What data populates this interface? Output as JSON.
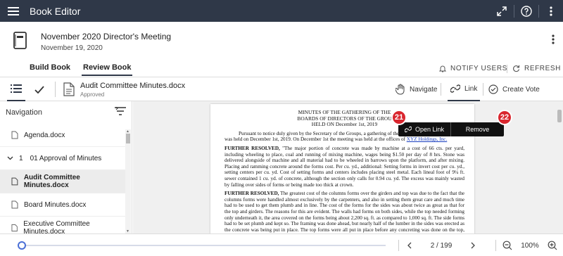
{
  "app": {
    "title": "Book Editor"
  },
  "meeting": {
    "title": "November 2020 Director's Meeting",
    "date": "November 19, 2020"
  },
  "tabs": [
    {
      "label": "Build Book",
      "active": false
    },
    {
      "label": "Review Book",
      "active": true
    }
  ],
  "actions": {
    "notify_users": "NOTIFY USERS",
    "refresh": "REFRESH"
  },
  "document": {
    "name": "Audit Committee Minutes.docx",
    "status": "Approved"
  },
  "modes": {
    "navigate": "Navigate",
    "link": "Link",
    "create_vote": "Create Vote",
    "active": "link"
  },
  "navigation": {
    "title": "Navigation",
    "items": [
      {
        "label": "Agenda.docx",
        "type": "file"
      },
      {
        "label": "01 Approval of Minutes",
        "type": "section",
        "number": "1"
      },
      {
        "label": "Audit Committee Minutes.docx",
        "type": "file",
        "selected": true
      },
      {
        "label": "Board Minutes.docx",
        "type": "file"
      },
      {
        "label": "Executive Committee Minutes.docx",
        "type": "file"
      }
    ]
  },
  "page_content": {
    "heading": [
      "MINUTES OF THE GATHERING OF THE",
      "BOARDS OF DIRECTORS OF THE GROU",
      "HELD ON December 1st, 2019"
    ],
    "para1_a": "Pursuant to notice duly given by the Secretary of the Groups, a gathering of the",
    "para1_b": "was held on December 1st, 2019. On December 1st the meeting was held at the offices of",
    "para1_link": "XYZ Holdings, Inc.",
    "para2_lead": "FURTHER RESOLVED,",
    "para2_body": " \"The major portion of concrete was made by machine at a cost of 66 cts. per yard, including wheeling to place, coal and running of mixing machine, wages being $1.50 per day of 8 hrs. Stone was delivered alongside of machine and all material had to be wheeled in barrows upon the platform, and after mixing. Placing and ramming concrete around the forms cost. Per cu. yd., additional: Setting forms in invert cost per cu. yd., setting centers per cu. yd. Cost of setting forms and centers includes placing steel metal. Each lineal foot of 9¼ ft. sewer contained 1 cu. yd. of concrete, although the section only calls for 0.94 cu. yd. The excess was mainly wasted by falling over sides of forms or being made too thick at crown.",
    "para3_lead": "FURTHER RESOLVED,",
    "para3_body": " The greatest cost of the columns forms over the girders and top was due to the fact that the columns forms were handled almost exclusively by the carpenters, and also in setting them great care and much time had to be used to get them plumb and in line. The cost of the forms for the sides was about twice as great as that for the top and girders. The reasons for this are evident. The walls had forms on both sides, while the top needed forming only underneath it, the area covered on the forms being about 2,200 sq. ft. as compared to 1,000 sq. ft. The side forms had to be set plumb and kept so. The framing was done ahead, but nearly half of the lumber in the sides was erected as the concrete was being put in place. The top forms were all put in place before any concreting was done on the top, and the"
  },
  "popup": {
    "open_link": "Open Link",
    "remove": "Remove"
  },
  "badges": {
    "open": "21",
    "remove": "22"
  },
  "pager": {
    "current": "2",
    "total": "199",
    "display": "2 / 199",
    "progress": 0.005
  },
  "zoom": {
    "value": "100%"
  },
  "colors": {
    "topbar": "#2f3848",
    "accent": "#4a6fd6",
    "badge": "#d9262e",
    "link": "#1a3fbf"
  },
  "icons": {
    "topbar": [
      "hamburger-icon",
      "expand-icon",
      "help-icon",
      "more-vertical-icon"
    ],
    "doc": "book-icon"
  }
}
